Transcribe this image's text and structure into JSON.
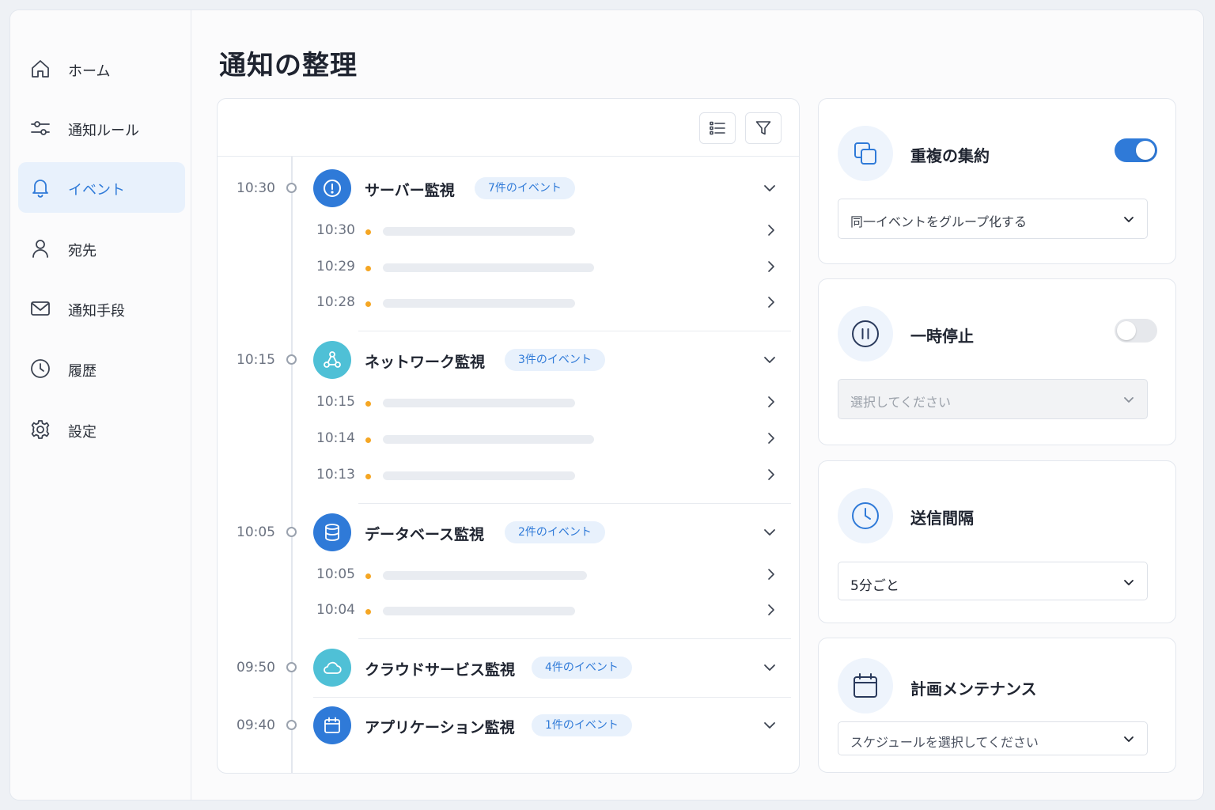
{
  "sidebar": {
    "items": [
      {
        "label": "ホーム",
        "icon": "home-icon"
      },
      {
        "label": "通知ルール",
        "icon": "sliders-icon"
      },
      {
        "label": "イベント",
        "icon": "bell-icon",
        "active": true
      },
      {
        "label": "宛先",
        "icon": "user-icon"
      },
      {
        "label": "通知手段",
        "icon": "mail-icon"
      },
      {
        "label": "履歴",
        "icon": "clock-icon"
      },
      {
        "label": "設定",
        "icon": "gear-icon"
      }
    ]
  },
  "page": {
    "title": "通知の整理"
  },
  "timeline": {
    "groups": [
      {
        "time": "10:30",
        "title": "サーバー監視",
        "badge": "7件のイベント",
        "icon": "alert-icon",
        "color": "#2f7ad8",
        "events": [
          {
            "time": "10:30"
          },
          {
            "time": "10:29"
          },
          {
            "time": "10:28"
          }
        ]
      },
      {
        "time": "10:15",
        "title": "ネットワーク監視",
        "badge": "3件のイベント",
        "icon": "network-icon",
        "color": "#4fc0d6",
        "events": [
          {
            "time": "10:15"
          },
          {
            "time": "10:14"
          },
          {
            "time": "10:13"
          }
        ]
      },
      {
        "time": "10:05",
        "title": "データベース監視",
        "badge": "2件のイベント",
        "icon": "database-icon",
        "color": "#2f7ad8",
        "events": [
          {
            "time": "10:05"
          },
          {
            "time": "10:04"
          }
        ]
      },
      {
        "time": "09:50",
        "title": "クラウドサービス監視",
        "badge": "4件のイベント",
        "icon": "cloud-icon",
        "color": "#4fc0d6",
        "events": []
      },
      {
        "time": "09:40",
        "title": "アプリケーション監視",
        "badge": "1件のイベント",
        "icon": "calendar-icon",
        "color": "#2f7ad8",
        "events": []
      }
    ]
  },
  "settings": {
    "dedupe": {
      "title": "重複の集約",
      "enabled": true,
      "select": "同一イベントをグループ化する"
    },
    "pause": {
      "title": "一時停止",
      "enabled": false,
      "select_placeholder": "選択してください"
    },
    "interval": {
      "title": "送信間隔",
      "select": "5分ごと"
    },
    "maintenance": {
      "title": "計画メンテナンス",
      "select_placeholder": "スケジュールを選択してください"
    }
  },
  "colors": {
    "accent": "#2f7ad8",
    "teal": "#4fc0d6",
    "event_dot": "#f5a623"
  }
}
